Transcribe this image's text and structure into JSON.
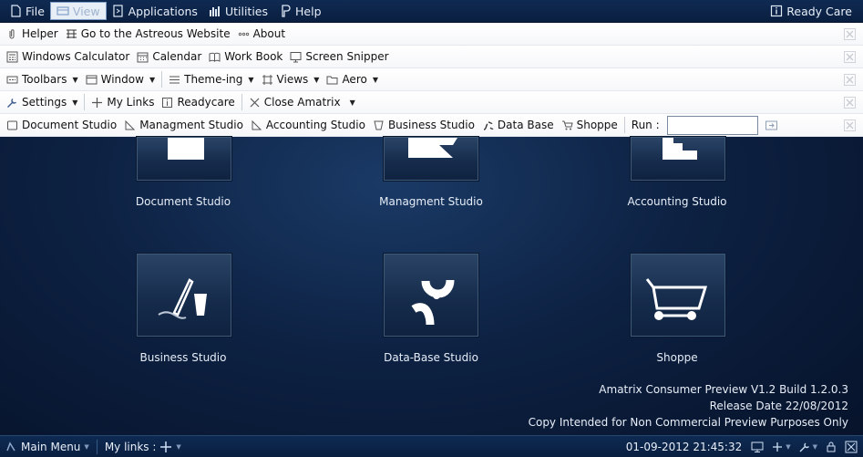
{
  "menubar": {
    "items": [
      {
        "label": "File",
        "icon": "file-icon"
      },
      {
        "label": "View",
        "icon": "view-icon"
      },
      {
        "label": "Applications",
        "icon": "applications-icon"
      },
      {
        "label": "Utilities",
        "icon": "utilities-icon"
      },
      {
        "label": "Help",
        "icon": "help-icon"
      }
    ],
    "right_label": "Ready Care"
  },
  "toolbars": {
    "row1": [
      "Helper",
      "Go to the Astreous Website",
      "About"
    ],
    "row2": [
      "Windows Calculator",
      "Calendar",
      "Work Book",
      "Screen Snipper"
    ],
    "row3": [
      "Toolbars",
      "Window",
      "Theme-ing",
      "Views",
      "Aero"
    ],
    "row4": [
      "Settings",
      "My Links",
      "Readycare",
      "Close Amatrix"
    ],
    "row5": [
      "Document Studio",
      "Managment Studio",
      "Accounting Studio",
      "Business Studio",
      "Data Base",
      "Shoppe"
    ],
    "run_label": "Run :",
    "run_value": ""
  },
  "tiles": [
    {
      "label": "Document Studio",
      "icon": "document-icon"
    },
    {
      "label": "Managment Studio",
      "icon": "management-icon"
    },
    {
      "label": "Accounting Studio",
      "icon": "accounting-icon"
    },
    {
      "label": "Business Studio",
      "icon": "pen-signature-icon"
    },
    {
      "label": "Data-Base Studio",
      "icon": "database-icon"
    },
    {
      "label": "Shoppe",
      "icon": "shopping-cart-icon"
    }
  ],
  "version": {
    "line1": "Amatrix Consumer Preview V1.2 Build 1.2.0.3",
    "line2": "Release Date 22/08/2012",
    "line3": "Copy Intended for Non Commercial Preview Purposes Only"
  },
  "taskbar": {
    "main_menu": "Main Menu",
    "my_links": "My links :",
    "datetime": "01-09-2012 21:45:32"
  },
  "colors": {
    "background": "#0d2142",
    "menubar": "#0f2a52",
    "toolbar": "#ffffff",
    "tile": "#1c3556"
  }
}
